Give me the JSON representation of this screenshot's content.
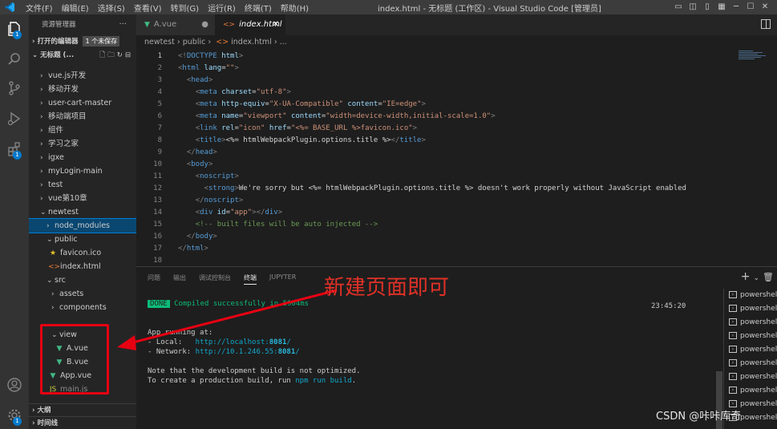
{
  "titlebar": {
    "menus": [
      "文件(F)",
      "编辑(E)",
      "选择(S)",
      "查看(V)",
      "转到(G)",
      "运行(R)",
      "终端(T)",
      "帮助(H)"
    ],
    "window_title": "index.html - 无标题 (工作区) - Visual Studio Code [管理员]"
  },
  "activity": {
    "badge_explorer": "1",
    "badge_settings": "1"
  },
  "sidebar": {
    "title": "资源管理器",
    "open_editors": "打开的编辑器",
    "unsaved": "1 个未保存",
    "workspace": "无标题 (...",
    "outline": "大纲",
    "timeline": "时间线",
    "items": [
      {
        "label": "vue.js开发"
      },
      {
        "label": "移动开发"
      },
      {
        "label": "user-cart-master"
      },
      {
        "label": "移动端项目"
      },
      {
        "label": "组件"
      },
      {
        "label": "学习之家"
      },
      {
        "label": "igxe"
      },
      {
        "label": "myLogin-main"
      },
      {
        "label": "test"
      },
      {
        "label": "vue第10章"
      },
      {
        "label": "newtest"
      },
      {
        "label": "node_modules"
      },
      {
        "label": "public"
      },
      {
        "label": "favicon.ico"
      },
      {
        "label": "index.html"
      },
      {
        "label": "src"
      },
      {
        "label": "assets"
      },
      {
        "label": "components"
      },
      {
        "label": "view"
      },
      {
        "label": "A.vue"
      },
      {
        "label": "B.vue"
      },
      {
        "label": "App.vue"
      },
      {
        "label": "main.js"
      }
    ]
  },
  "editor": {
    "tabs": [
      {
        "label": "A.vue"
      },
      {
        "label": "index.html"
      }
    ],
    "breadcrumb": [
      "newtest",
      "public",
      "index.html",
      "..."
    ],
    "lines": [
      {
        "n": "1"
      },
      {
        "n": "2"
      },
      {
        "n": "3"
      },
      {
        "n": "4"
      },
      {
        "n": "5"
      },
      {
        "n": "6"
      },
      {
        "n": "7"
      },
      {
        "n": "8"
      },
      {
        "n": "9"
      },
      {
        "n": "10"
      },
      {
        "n": "11"
      },
      {
        "n": "12"
      },
      {
        "n": "13"
      },
      {
        "n": "14"
      },
      {
        "n": "15"
      },
      {
        "n": "16"
      },
      {
        "n": "17"
      },
      {
        "n": "18"
      }
    ],
    "code": {
      "l1": "html",
      "l2_attr": "lang",
      "l2_val": "\"\"",
      "l4_val": "\"utf-8\"",
      "l5_val1": "\"X-UA-Compatible\"",
      "l5_val2": "\"IE=edge\"",
      "l6_val1": "\"viewport\"",
      "l6_val2": "\"width=device-width,initial-scale=1.0\"",
      "l7_val1": "\"icon\"",
      "l7_val2": "\"<%= BASE_URL %>favicon.ico\"",
      "l8_text": "<%= htmlWebpackPlugin.options.title %>",
      "l12_text": "We're sorry but <%= htmlWebpackPlugin.options.title %> doesn't work properly without JavaScript enabled",
      "l14_val": "\"app\"",
      "l15_comment": "<!-- built files will be auto injected -->"
    }
  },
  "panel": {
    "tabs": [
      "问题",
      "输出",
      "调试控制台",
      "终端",
      "JUPYTER"
    ],
    "done": "DONE",
    "compiled": "Compiled successfully in 5904ms",
    "time": "23:45:20",
    "running": "App running at:",
    "local_label": "- Local:   ",
    "local_url_prefix": "http://localhost:",
    "local_port": "8081",
    "network_label": "- Network: ",
    "network_url_prefix": "http://10.1.246.55:",
    "network_port": "8081",
    "note": "Note that the development build is not optimized.",
    "create_prefix": "To create a production build, run ",
    "create_cmd": "npm run build",
    "create_suffix": ".",
    "terminals": [
      "powershell",
      "powershell",
      "powershell",
      "powershell",
      "powershell",
      "powershell",
      "powershell",
      "powershell",
      "powershell",
      "powershell"
    ]
  },
  "annotation": {
    "text": "新建页面即可"
  },
  "watermark": "CSDN @咔咔库奇",
  "colors": {
    "accent": "#007acc",
    "annotation_red": "#e60012",
    "vue_green": "#41b883"
  }
}
